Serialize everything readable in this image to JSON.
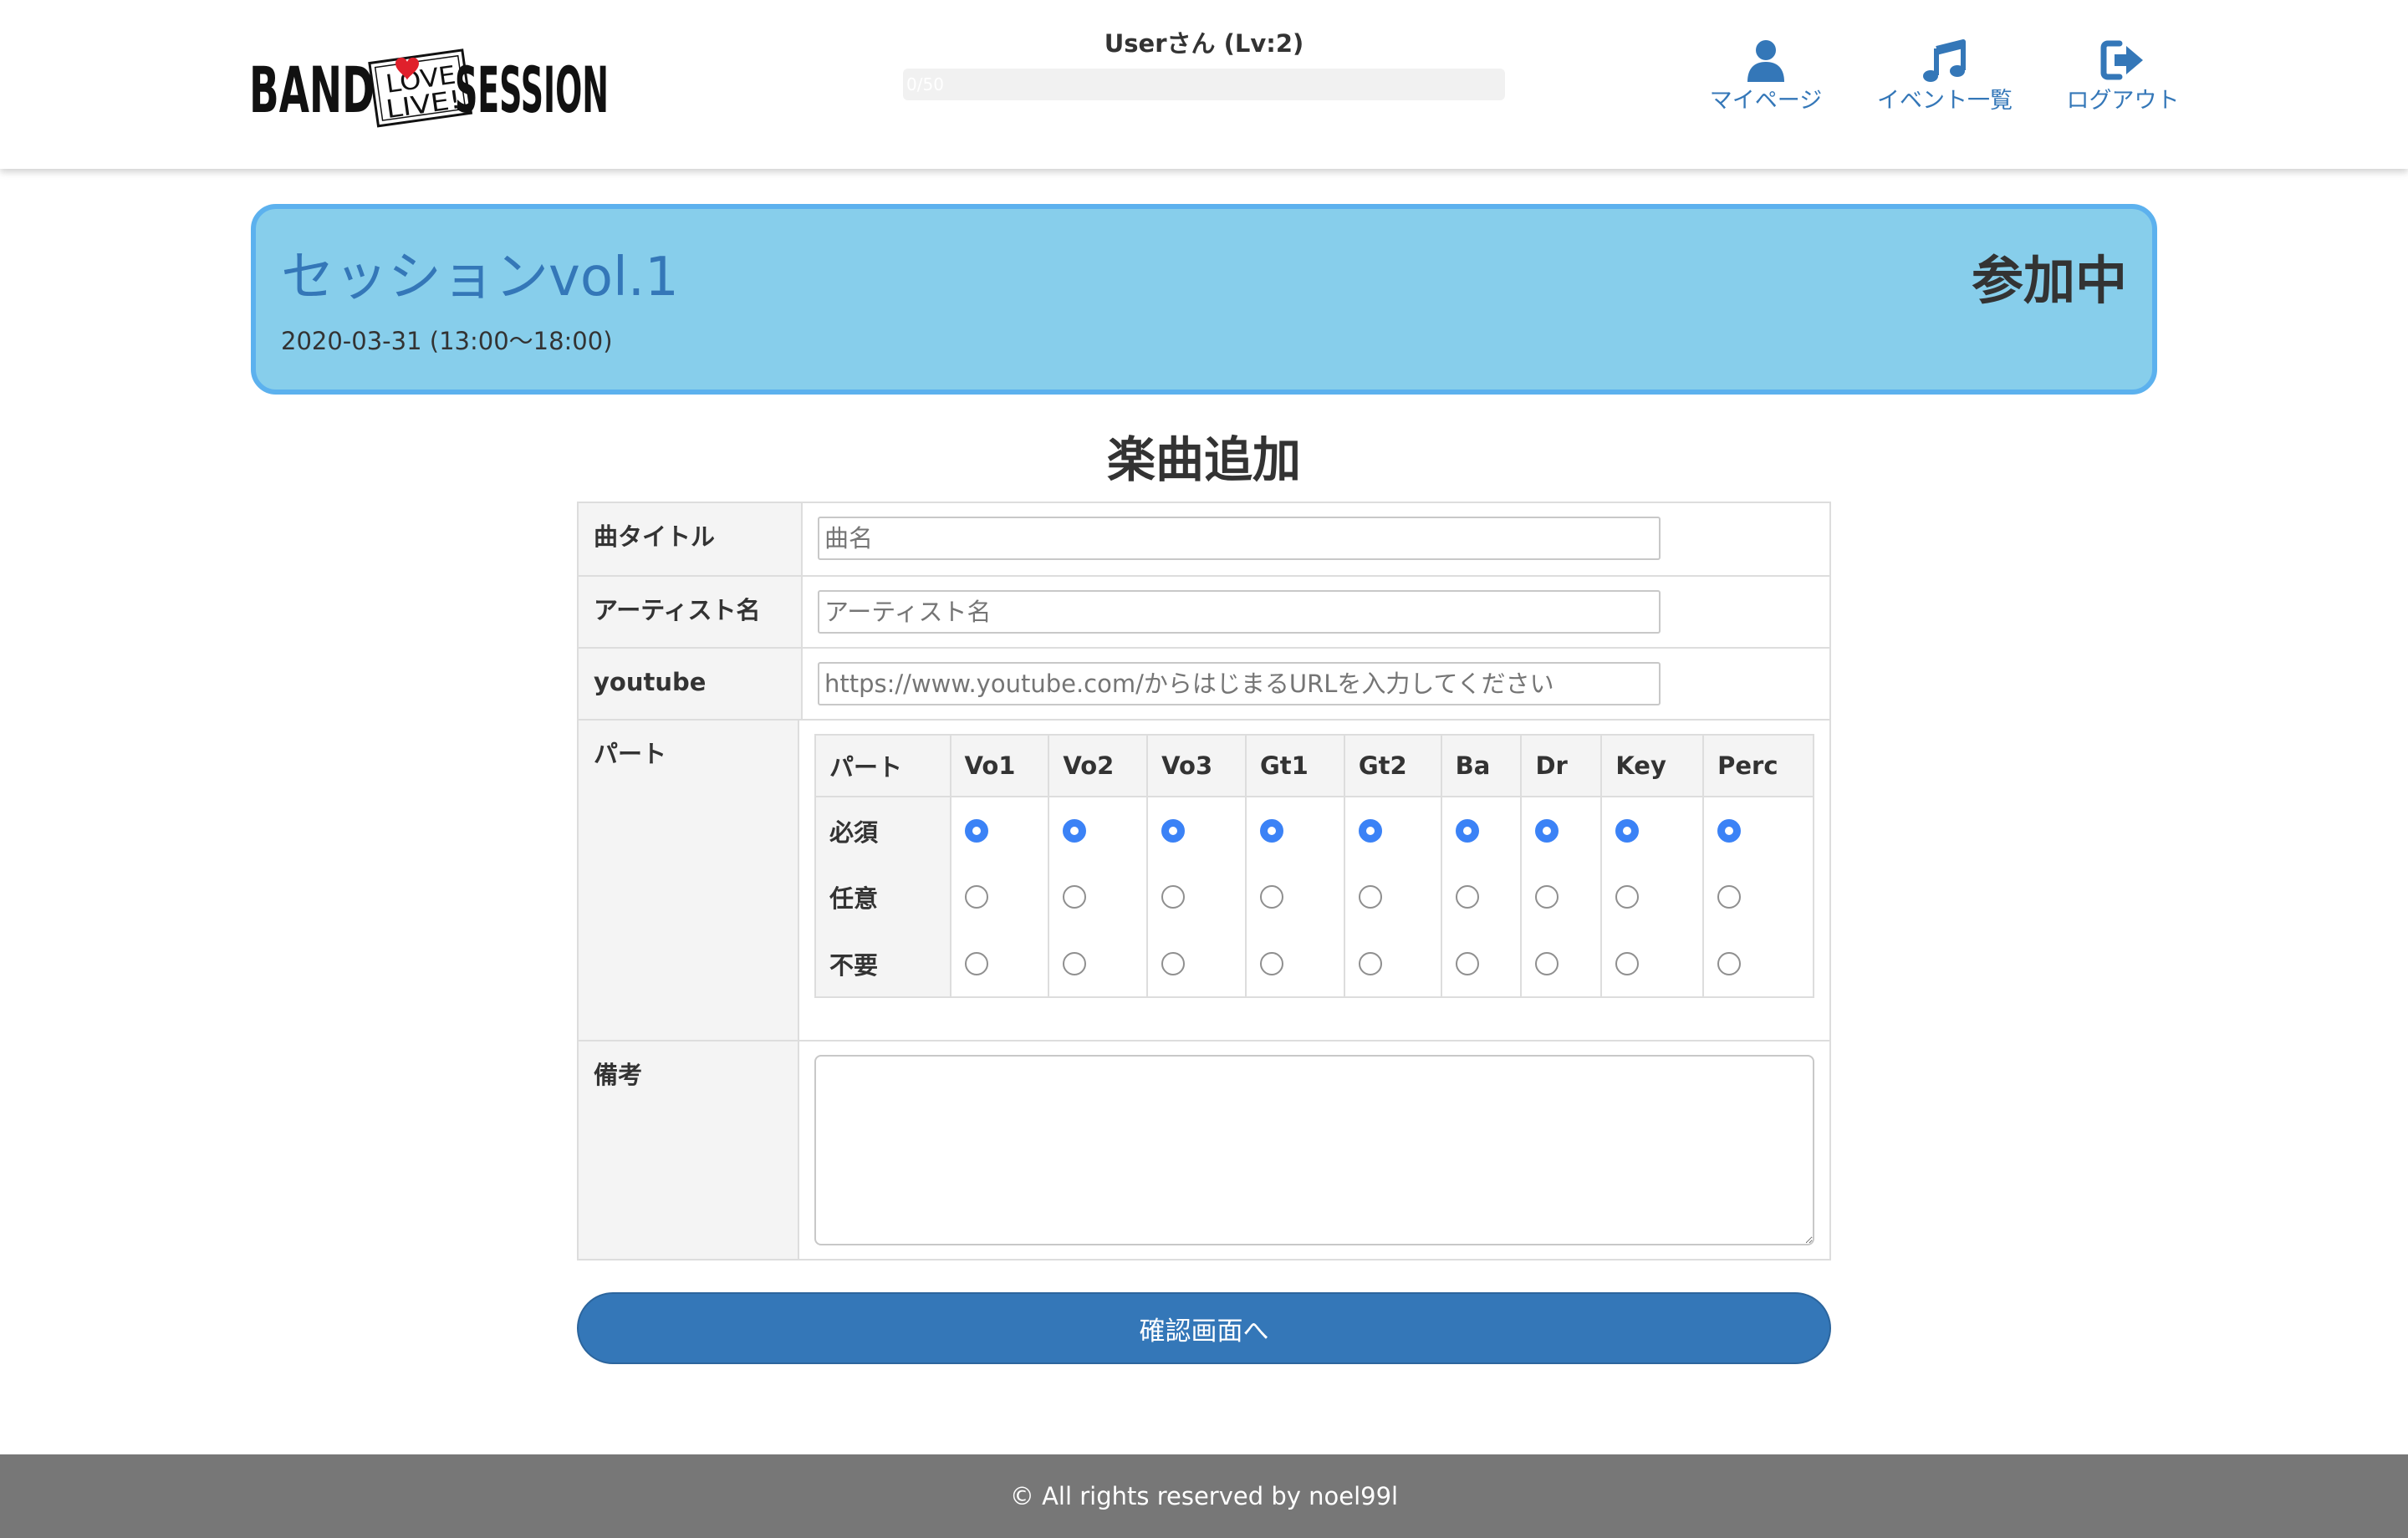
{
  "header": {
    "logo": {
      "left_text": "BAND",
      "stamp_line1": "LOVE",
      "stamp_line2": "LIVE!",
      "right_text": "SESSION",
      "heart_color": "#e0202b"
    },
    "user_name": "Userさん (Lv:2)",
    "level_progress": {
      "label": "0/50",
      "value": 0,
      "max": 50
    },
    "nav": [
      {
        "label": "マイページ",
        "icon": "user-icon"
      },
      {
        "label": "イベント一覧",
        "icon": "music-note-icon"
      },
      {
        "label": "ログアウト",
        "icon": "sign-out-icon"
      }
    ]
  },
  "event": {
    "title": "セッションvol.1",
    "date": "2020-03-31 (13:00〜18:00)",
    "status": "参加中"
  },
  "page_title": "楽曲追加",
  "form": {
    "title_label": "曲タイトル",
    "title_placeholder": "曲名",
    "artist_label": "アーティスト名",
    "artist_placeholder": "アーティスト名",
    "youtube_label": "youtube",
    "youtube_placeholder": "https://www.youtube.com/からはじまるURLを入力してください",
    "part_label": "パート",
    "note_label": "備考",
    "note_value": "",
    "parts_table": {
      "header_label": "パート",
      "parts": [
        "Vo1",
        "Vo2",
        "Vo3",
        "Gt1",
        "Gt2",
        "Ba",
        "Dr",
        "Key",
        "Perc"
      ],
      "levels": [
        "必須",
        "任意",
        "不要"
      ],
      "selected": [
        "必須",
        "必須",
        "必須",
        "必須",
        "必須",
        "必須",
        "必須",
        "必須",
        "必須"
      ]
    }
  },
  "submit_label": "確認画面へ",
  "footer": {
    "text": "© All rights reserved by noel99l"
  },
  "colors": {
    "accent": "#3477b8",
    "banner_bg": "#87ceeb",
    "banner_border": "#5cb1ee",
    "footer_bg": "#777777",
    "radio_checked": "#3b82f6"
  }
}
